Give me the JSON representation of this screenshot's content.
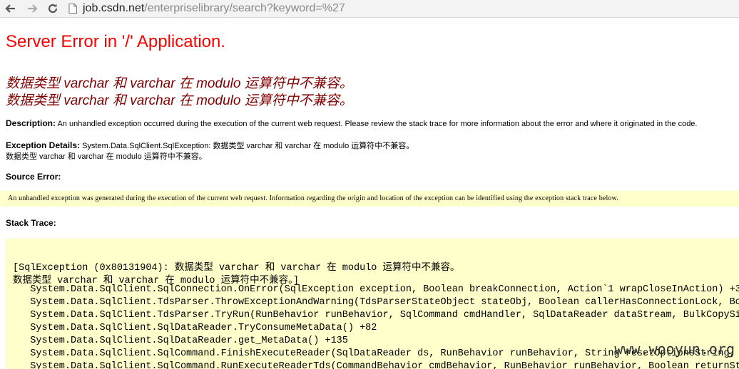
{
  "browser": {
    "url_host": "job.csdn.net",
    "url_path": "/enterpriselibrary/search?keyword=%27"
  },
  "page": {
    "title": "Server Error in '/' Application.",
    "error_line_1": "数据类型 varchar 和 varchar 在 modulo 运算符中不兼容。",
    "error_line_2": "数据类型 varchar 和 varchar 在 modulo 运算符中不兼容。",
    "description_label": "Description:",
    "description_text": " An unhandled exception occurred during the execution of the current web request. Please review the stack trace for more information about the error and where it originated in the code.",
    "exception_label": "Exception Details:",
    "exception_text": " System.Data.SqlClient.SqlException: 数据类型 varchar 和 varchar 在 modulo 运算符中不兼容。",
    "exception_text_2": "数据类型 varchar 和 varchar 在 modulo 运算符中不兼容。",
    "source_error_label": "Source Error:",
    "source_error_text": "An unhandled exception was generated during the execution of the current web request. Information regarding the origin and location of the exception can be identified using the exception stack trace below.",
    "stack_trace_label": "Stack Trace:",
    "stack_lines": [
      "[SqlException (0x80131904): 数据类型 varchar 和 varchar 在 modulo 运算符中不兼容。",
      "数据类型 varchar 和 varchar 在 modulo 运算符中不兼容。]",
      "   System.Data.SqlClient.SqlConnection.OnError(SqlException exception, Boolean breakConnection, Action`1 wrapCloseInAction) +3",
      "   System.Data.SqlClient.TdsParser.ThrowExceptionAndWarning(TdsParserStateObject stateObj, Boolean callerHasConnectionLock, Bo",
      "   System.Data.SqlClient.TdsParser.TryRun(RunBehavior runBehavior, SqlCommand cmdHandler, SqlDataReader dataStream, BulkCopySi",
      "   System.Data.SqlClient.SqlDataReader.TryConsumeMetaData() +82",
      "   System.Data.SqlClient.SqlDataReader.get_MetaData() +135",
      "   System.Data.SqlClient.SqlCommand.FinishExecuteReader(SqlDataReader ds, RunBehavior runBehavior, String resetOptionsString,",
      "   System.Data.SqlClient.SqlCommand.RunExecuteReaderTds(CommandBehavior cmdBehavior, RunBehavior runBehavior, Boolean returnStr"
    ],
    "watermark": "www.wooyun.org"
  }
}
